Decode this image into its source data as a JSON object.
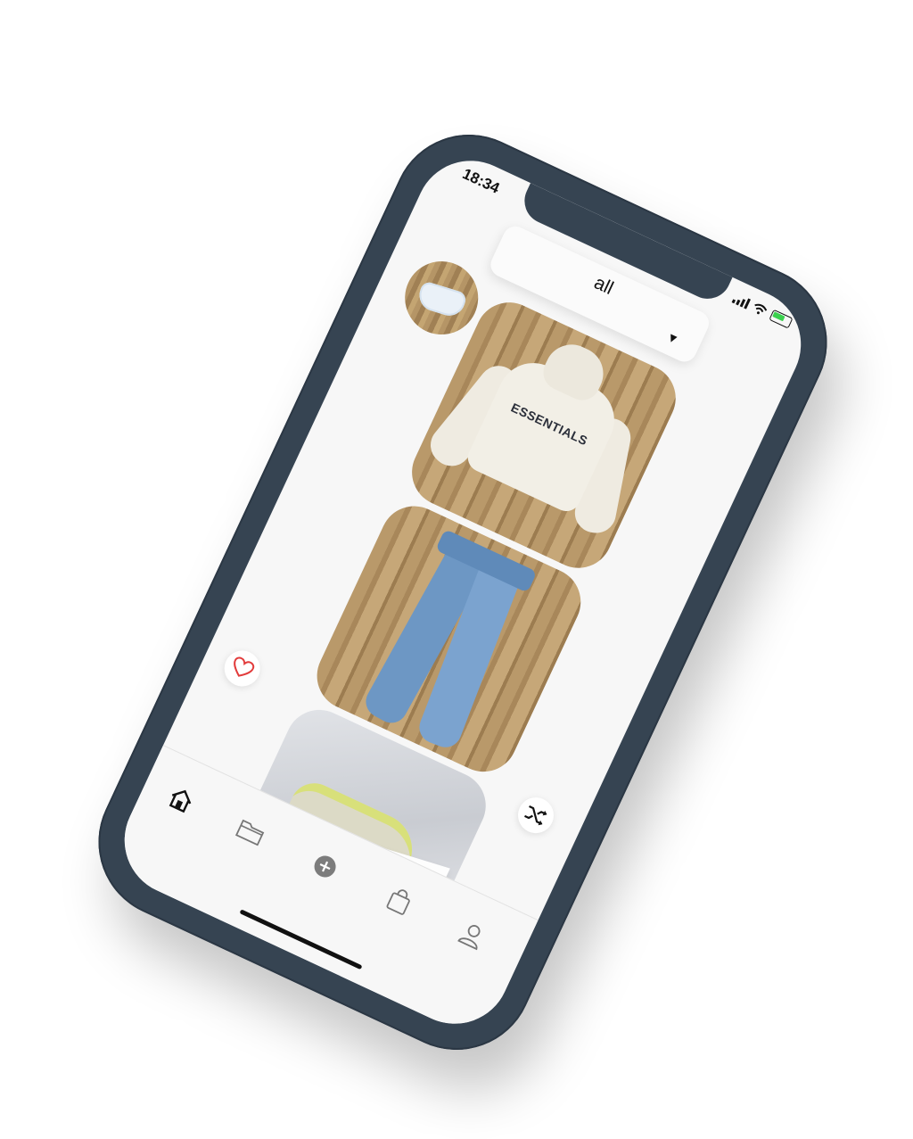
{
  "status_bar": {
    "time": "18:34"
  },
  "filter_dropdown": {
    "value": "all",
    "caret": "▼"
  },
  "wardrobe_items": [
    {
      "kind": "hoodie",
      "print": "ESSENTIALS"
    },
    {
      "kind": "jeans"
    },
    {
      "kind": "sneaker"
    }
  ],
  "tab_bar": {
    "items": [
      {
        "icon": "home-icon"
      },
      {
        "icon": "folder-icon"
      },
      {
        "icon": "add-icon"
      },
      {
        "icon": "bag-icon"
      },
      {
        "icon": "profile-icon"
      }
    ]
  },
  "colors": {
    "phone_frame": "#364452",
    "screen_bg": "#f7f7f7",
    "heart": "#e23b3b",
    "battery": "#3bd14e"
  }
}
